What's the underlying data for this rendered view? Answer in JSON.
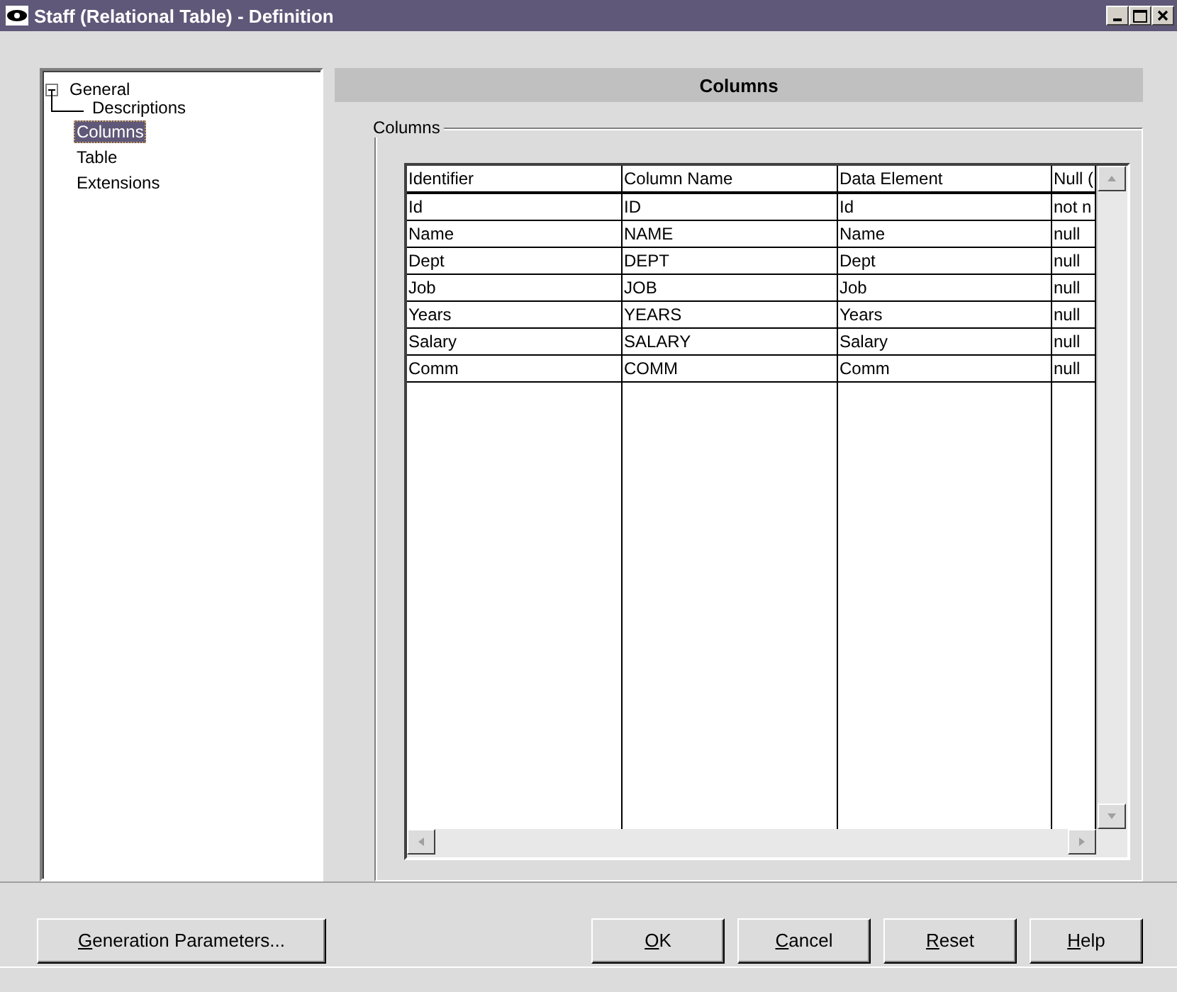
{
  "window": {
    "title": "Staff (Relational Table) - Definition"
  },
  "tree": [
    {
      "label": "General",
      "expanded": true,
      "selected": false,
      "children": [
        {
          "label": "Descriptions",
          "selected": false
        }
      ]
    },
    {
      "label": "Columns",
      "selected": true
    },
    {
      "label": "Table",
      "selected": false
    },
    {
      "label": "Extensions",
      "selected": false
    }
  ],
  "panel": {
    "header": "Columns",
    "group_label": "Columns"
  },
  "table": {
    "columns": [
      "Identifier",
      "Column Name",
      "Data Element",
      "Null ("
    ],
    "rows": [
      [
        "Id",
        "ID",
        "Id",
        "not n"
      ],
      [
        "Name",
        "NAME",
        "Name",
        "null"
      ],
      [
        "Dept",
        "DEPT",
        "Dept",
        "null"
      ],
      [
        "Job",
        "JOB",
        "Job",
        "null"
      ],
      [
        "Years",
        "YEARS",
        "Years",
        "null"
      ],
      [
        "Salary",
        "SALARY",
        "Salary",
        "null"
      ],
      [
        "Comm",
        "COMM",
        "Comm",
        "null"
      ]
    ]
  },
  "left_button": {
    "accel": "G",
    "rest": "eneration Parameters..."
  },
  "buttons": [
    {
      "accel": "O",
      "rest": "K"
    },
    {
      "accel": "C",
      "rest": "ancel"
    },
    {
      "accel": "R",
      "rest": "eset"
    },
    {
      "accel": "H",
      "rest": "elp"
    }
  ]
}
